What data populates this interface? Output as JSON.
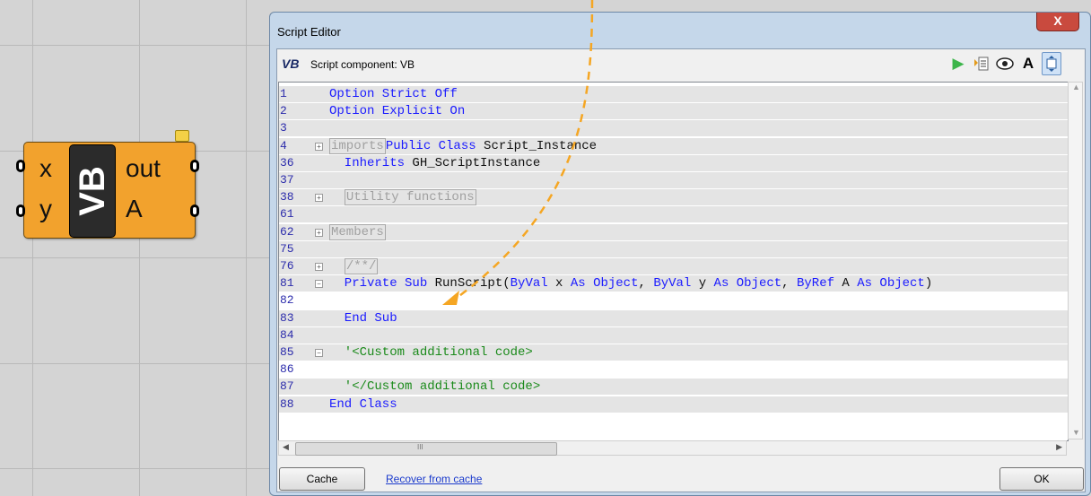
{
  "component": {
    "inputs": [
      "x",
      "y"
    ],
    "outputs": [
      "out",
      "A"
    ],
    "nickname": "VB",
    "color": "#f2a22d"
  },
  "window": {
    "title": "Script Editor",
    "close_label": "X",
    "header_text": "Script component: VB",
    "header_icon_text": "VB",
    "toolbar_icons": [
      "play-icon",
      "insert-icon",
      "eye-icon",
      "font-icon",
      "fit-icon"
    ],
    "toolbar_text": "A"
  },
  "editor": {
    "lines": [
      {
        "num": "1",
        "parts": [
          {
            "t": "Option Strict Off",
            "c": "kw"
          }
        ]
      },
      {
        "num": "2",
        "parts": [
          {
            "t": "Option Explicit On",
            "c": "kw"
          }
        ]
      },
      {
        "num": "3",
        "parts": []
      },
      {
        "num": "4",
        "parts": [
          {
            "t": "imports",
            "c": "box"
          },
          {
            "t": "Public Class",
            "c": "kw"
          },
          {
            "t": " Script_Instance",
            "c": "tx"
          }
        ],
        "fold": "+"
      },
      {
        "num": "36",
        "parts": [
          {
            "t": "  Inherits",
            "c": "kw"
          },
          {
            "t": " GH_ScriptInstance",
            "c": "tx"
          }
        ]
      },
      {
        "num": "37",
        "parts": []
      },
      {
        "num": "38",
        "parts": [
          {
            "t": "  ",
            "c": "tx"
          },
          {
            "t": "Utility functions",
            "c": "box"
          }
        ],
        "fold": "+"
      },
      {
        "num": "61",
        "parts": []
      },
      {
        "num": "62",
        "parts": [
          {
            "t": "Members",
            "c": "box"
          }
        ],
        "fold": "+"
      },
      {
        "num": "75",
        "parts": []
      },
      {
        "num": "76",
        "parts": [
          {
            "t": "  ",
            "c": "tx"
          },
          {
            "t": "/**/",
            "c": "box"
          }
        ],
        "fold": "+"
      },
      {
        "num": "81",
        "parts": [
          {
            "t": "  Private Sub",
            "c": "kw"
          },
          {
            "t": " RunScript(",
            "c": "tx"
          },
          {
            "t": "ByVal",
            "c": "kw"
          },
          {
            "t": " x ",
            "c": "tx"
          },
          {
            "t": "As Object",
            "c": "kw"
          },
          {
            "t": ", ",
            "c": "tx"
          },
          {
            "t": "ByVal",
            "c": "kw"
          },
          {
            "t": " y ",
            "c": "tx"
          },
          {
            "t": "As Object",
            "c": "kw"
          },
          {
            "t": ", ",
            "c": "tx"
          },
          {
            "t": "ByRef",
            "c": "kw"
          },
          {
            "t": " A ",
            "c": "tx"
          },
          {
            "t": "As Object",
            "c": "kw"
          },
          {
            "t": ")",
            "c": "tx"
          }
        ],
        "fold": "-"
      },
      {
        "num": "82",
        "parts": [],
        "editable": true
      },
      {
        "num": "83",
        "parts": [
          {
            "t": "  End Sub",
            "c": "kw"
          }
        ]
      },
      {
        "num": "84",
        "parts": []
      },
      {
        "num": "85",
        "parts": [
          {
            "t": "  '<Custom additional code>",
            "c": "cm"
          }
        ],
        "fold": "-"
      },
      {
        "num": "86",
        "parts": [],
        "editable": true
      },
      {
        "num": "87",
        "parts": [
          {
            "t": "  '</Custom additional code>",
            "c": "cm"
          }
        ]
      },
      {
        "num": "88",
        "parts": [
          {
            "t": "End Class",
            "c": "kw"
          }
        ]
      }
    ]
  },
  "scroll": {
    "h_thumb_glyph": "III"
  },
  "footer": {
    "cache_label": "Cache",
    "recover_label": "Recover from cache",
    "ok_label": "OK"
  },
  "colors": {
    "arrow": "#f5a623",
    "keyword": "#1a1aff",
    "comment": "#1a8a1a",
    "readonly_bg": "#e4e4e4"
  }
}
